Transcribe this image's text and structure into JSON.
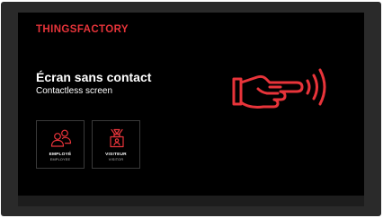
{
  "brand": {
    "name": "THINGSFACTORY"
  },
  "hero": {
    "title": "Écran sans contact",
    "subtitle": "Contactless screen",
    "icon": "contactless-hand-icon"
  },
  "options": [
    {
      "label": "EMPLOYÉ",
      "sublabel": "EMPLOYEE",
      "icon": "people-icon"
    },
    {
      "label": "VISITEUR",
      "sublabel": "VISITOR",
      "icon": "visitor-badge-icon"
    }
  ],
  "colors": {
    "accent": "#e8343a",
    "screen_background": "#000000",
    "bezel": "#2a2a2a",
    "text_primary": "#ffffff"
  }
}
